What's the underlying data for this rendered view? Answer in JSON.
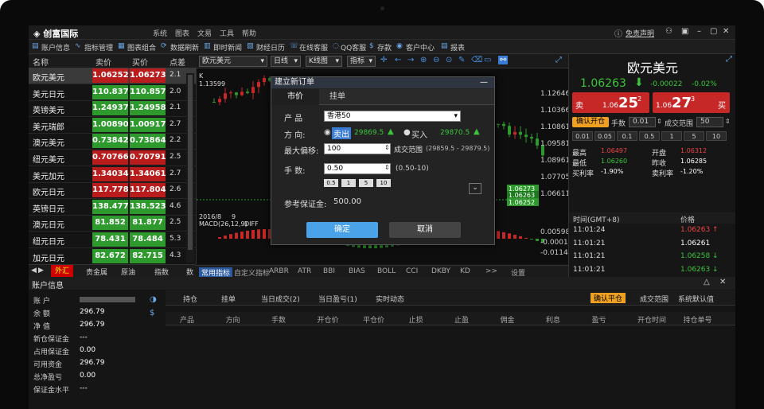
{
  "app": {
    "title": "创富国际",
    "menu": [
      "系统",
      "图表",
      "文易",
      "工具",
      "帮助"
    ],
    "right_link": "免责声明"
  },
  "toolbar": [
    "账户信息",
    "指标管理",
    "图表组合",
    "数据刷新",
    "即时新闻",
    "财经日历",
    "在线客服",
    "QQ客服",
    "存款",
    "客户中心",
    "报表"
  ],
  "quotes": {
    "headers": [
      "名称",
      "卖价",
      "买价",
      "点差"
    ],
    "rows": [
      {
        "name": "欧元美元",
        "bid": "1.06252",
        "ask": "1.06273",
        "pt": "2.1",
        "dir": "up",
        "sel": true
      },
      {
        "name": "美元日元",
        "bid": "110.837",
        "ask": "110.857",
        "pt": "2.0",
        "dir": "dn"
      },
      {
        "name": "英镑美元",
        "bid": "1.24937",
        "ask": "1.24958",
        "pt": "2.1",
        "dir": "dn"
      },
      {
        "name": "美元瑞郎",
        "bid": "1.00890",
        "ask": "1.00917",
        "pt": "2.7",
        "dir": "dn"
      },
      {
        "name": "澳元美元",
        "bid": "0.73842",
        "ask": "0.73864",
        "pt": "2.2",
        "dir": "dn"
      },
      {
        "name": "纽元美元",
        "bid": "0.70766",
        "ask": "0.70791",
        "pt": "2.5",
        "dir": "up"
      },
      {
        "name": "美元加元",
        "bid": "1.34034",
        "ask": "1.34061",
        "pt": "2.7",
        "dir": "up"
      },
      {
        "name": "欧元日元",
        "bid": "117.778",
        "ask": "117.804",
        "pt": "2.6",
        "dir": "up"
      },
      {
        "name": "英镑日元",
        "bid": "138.477",
        "ask": "138.523",
        "pt": "4.6",
        "dir": "dn"
      },
      {
        "name": "澳元日元",
        "bid": "81.852",
        "ask": "81.877",
        "pt": "2.5",
        "dir": "dn"
      },
      {
        "name": "纽元日元",
        "bid": "78.431",
        "ask": "78.484",
        "pt": "5.3",
        "dir": "dn"
      },
      {
        "name": "加元日元",
        "bid": "82.672",
        "ask": "82.715",
        "pt": "4.3",
        "dir": "dn"
      }
    ],
    "tabs": [
      "外汇",
      "贵金属",
      "原油",
      "指数",
      "数"
    ]
  },
  "chart": {
    "symbol": "欧元美元",
    "period": "日线",
    "type": "K线图",
    "indicator": "指标",
    "k_label": "K",
    "k_value": "1.13599",
    "yticks": [
      "1.12646",
      "1.10366",
      "1.10861",
      "1.09581",
      "1.08961",
      "1.07705",
      "1.06611"
    ],
    "price_tag_ask": "1.06273",
    "price_tag_mid": "1.06263",
    "price_tag_bid": "1.06252",
    "date_label": "2016/8",
    "date_num": "9",
    "macd_label": "MACD(26,12,9)",
    "diff_label": "DIFF",
    "macd_ticks": [
      "0.00598",
      "-0.00011",
      "-0.01148"
    ],
    "ind_tabs": [
      "常用指标",
      "自定义指标",
      "ARBR",
      "ATR",
      "BBI",
      "BIAS",
      "BOLL",
      "CCI",
      "DKBY",
      "KD",
      ">>",
      "设置"
    ]
  },
  "dialog": {
    "title": "建立新订单",
    "tabs": [
      "市价",
      "挂单"
    ],
    "product_label": "产 品",
    "product_value": "香港50",
    "dir_label": "方 向:",
    "sell_label": "卖出",
    "sell_price": "29869.5",
    "buy_label": "买入",
    "buy_price": "29870.5",
    "slip_label": "最大偏移:",
    "slip_value": "100",
    "range_label": "成交范围",
    "range_value": "(29859.5 - 29879.5)",
    "lots_label": "手 数:",
    "lots_value": "0.50",
    "lots_range": "(0.50-10)",
    "quick": [
      "0.5",
      "1",
      "5",
      "10"
    ],
    "margin_label": "参考保证金:",
    "margin_value": "500.00",
    "ok": "确定",
    "cancel": "取消"
  },
  "right": {
    "symbol": "欧元美元",
    "price": "1.06263",
    "change": "-0.00022",
    "pct": "-0.02%",
    "sell": "卖",
    "buy": "买",
    "sell_price_small": "1.06",
    "sell_price_big": "25",
    "sell_sup": "2",
    "buy_price_small": "1.06",
    "buy_price_big": "27",
    "buy_sup": "3",
    "confirm": "确认开仓",
    "lots_label": "手数",
    "lots": "0.01",
    "range_label": "成交范围",
    "range": "50",
    "quick": [
      "0.01",
      "0.05",
      "0.1",
      "0.5",
      "1",
      "5",
      "10"
    ],
    "stats": [
      {
        "k": "最高",
        "v": "1.06497"
      },
      {
        "k": "开盘",
        "v": "1.06312"
      },
      {
        "k": "最低",
        "v": "1.06260"
      },
      {
        "k": "昨收",
        "v": "1.06285"
      },
      {
        "k": "买利率",
        "v": "-1.90%"
      },
      {
        "k": "卖利率",
        "v": "-1.20%"
      }
    ],
    "ticks_header": [
      "时间(GMT+8)",
      "价格"
    ],
    "ticks": [
      {
        "t": "11:01:24",
        "p": "1.06263",
        "d": "up"
      },
      {
        "t": "11:01:21",
        "p": "1.06261",
        "d": ""
      },
      {
        "t": "11:01:21",
        "p": "1.06258",
        "d": "dn"
      },
      {
        "t": "11:01:21",
        "p": "1.06263",
        "d": "dn"
      },
      {
        "t": "11:01:20",
        "p": "1.06264",
        "d": "dn"
      },
      {
        "t": "11:01:19",
        "p": "1.06263",
        "d": "up"
      }
    ]
  },
  "account": {
    "title": "账户信息",
    "rows": [
      {
        "k": "账 户",
        "v": ""
      },
      {
        "k": "余 额",
        "v": "296.79"
      },
      {
        "k": "净 值",
        "v": "296.79"
      },
      {
        "k": "新仓保证金",
        "v": "---"
      },
      {
        "k": "占用保证金",
        "v": "0.00"
      },
      {
        "k": "可用资金",
        "v": "296.79"
      },
      {
        "k": "总净盈亏",
        "v": "0.00"
      },
      {
        "k": "保证金水平",
        "v": "---"
      }
    ],
    "tabs": [
      "持仓",
      "挂单",
      "当日成交(2)",
      "当日盈亏(1)",
      "实时动态"
    ],
    "right_btns": [
      "确认平仓",
      "成交范围",
      "系统默认值"
    ],
    "cols": [
      "产品",
      "方向",
      "手数",
      "开仓价",
      "平仓价",
      "止损",
      "止盈",
      "佣金",
      "利息",
      "盈亏",
      "开仓时间",
      "持仓单号"
    ]
  }
}
